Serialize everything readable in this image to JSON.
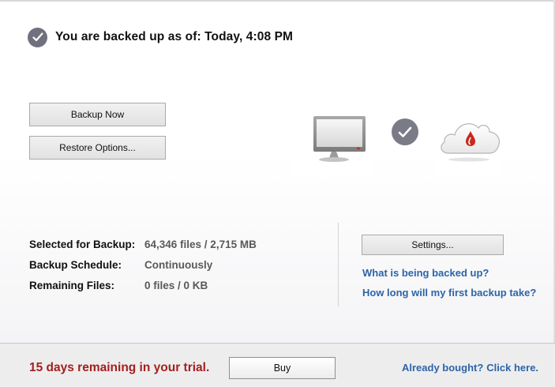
{
  "status": {
    "text": "You are backed up as of: Today, 4:08 PM",
    "icon": "check-circle-icon"
  },
  "actions": {
    "backup_now": "Backup Now",
    "restore_options": "Restore Options...",
    "settings": "Settings..."
  },
  "illustration": {
    "computer_icon": "computer-monitor-icon",
    "check_icon": "check-circle-icon",
    "cloud_icon": "cloud-drop-icon"
  },
  "info": {
    "selected_label": "Selected for Backup:",
    "selected_value": "64,346 files / 2,715 MB",
    "schedule_label": "Backup Schedule:",
    "schedule_value": "Continuously",
    "remaining_label": "Remaining Files:",
    "remaining_value": "0 files / 0 KB"
  },
  "links": {
    "what_backed_up": "What is being backed up?",
    "how_long": "How long will my first backup take?"
  },
  "footer": {
    "trial_text": "15 days remaining in your trial.",
    "buy_label": "Buy",
    "already_bought": "Already bought?",
    "click_here": "Click here."
  },
  "colors": {
    "trial_red": "#a3201d",
    "link_blue": "#2c64a8",
    "check_badge": "#70707e",
    "cloud_drop_red": "#c8281e"
  }
}
